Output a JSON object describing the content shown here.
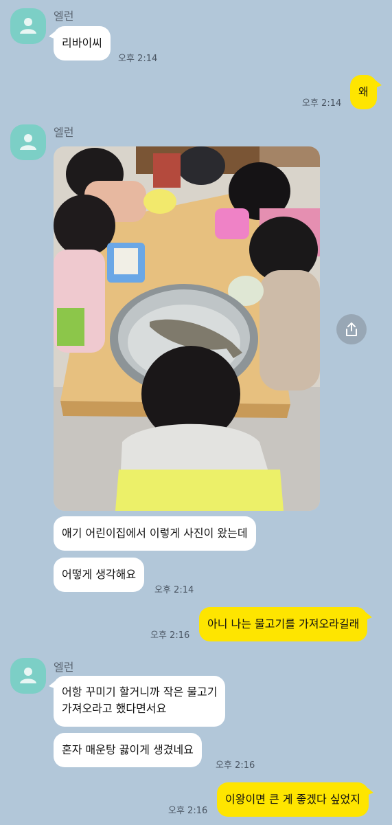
{
  "contact": {
    "name": "엘런"
  },
  "messages": [
    {
      "from": "in",
      "text": "리바이씨"
    },
    {
      "from": "out",
      "text": "왜"
    },
    {
      "from": "in",
      "text": "애기 어린이집에서 이렇게 사진이 왔는데"
    },
    {
      "from": "in",
      "text": "어떻게 생각해요"
    },
    {
      "from": "out",
      "text": "아니 나는 물고기를 가져오라길래"
    },
    {
      "from": "in",
      "text_lines": [
        "어항 꾸미기 할거니까 작은 물고기",
        "가져오라고 했다면서요"
      ]
    },
    {
      "from": "in",
      "text": "혼자 매운탕 끓이게 생겼네요"
    },
    {
      "from": "out",
      "text": "이왕이면 큰 게 좋겠다 싶었지"
    }
  ],
  "timestamps": {
    "t1": "오후 2:14",
    "t2": "오후 2:14",
    "t3": "오후 2:14",
    "t4": "오후 2:16",
    "t5": "오후 2:16",
    "t6": "오후 2:16"
  },
  "icons": {
    "avatar": "person-icon",
    "share": "share-icon"
  },
  "colors": {
    "background": "#b2c7d9",
    "incoming_bubble": "#ffffff",
    "outgoing_bubble": "#fee500",
    "avatar": "#7ccfc6"
  }
}
